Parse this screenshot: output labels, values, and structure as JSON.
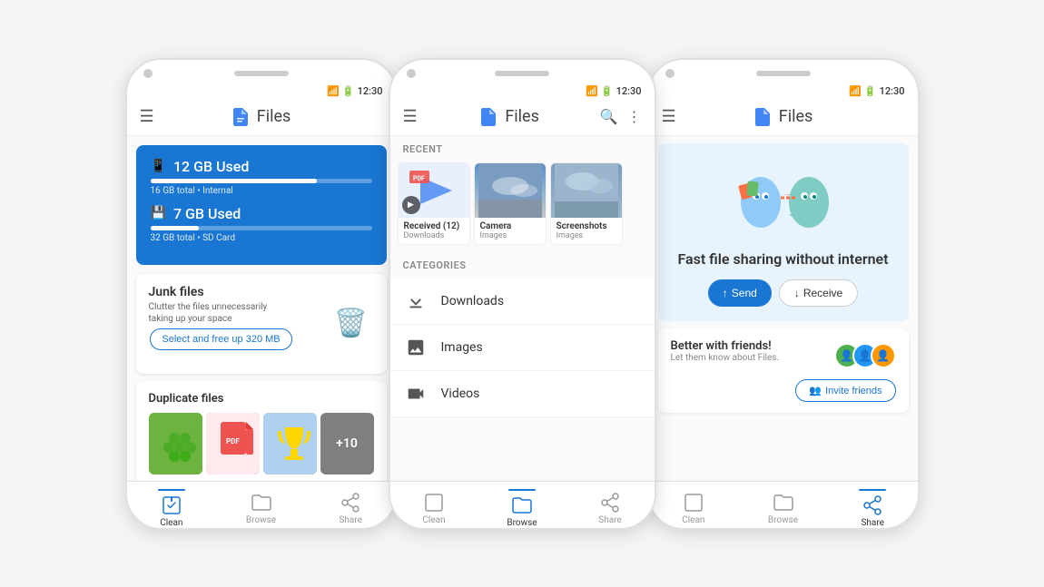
{
  "phone1": {
    "time": "12:30",
    "app_title": "Files",
    "storage1": {
      "label": "12 GB Used",
      "sub": "16 GB total • Internal",
      "progress": 75
    },
    "storage2": {
      "label": "7 GB Used",
      "sub": "32 GB total • SD Card",
      "progress": 22
    },
    "junk": {
      "title": "Junk files",
      "desc": "Clutter the files unnecessarily taking up your space",
      "btn": "Select and free up 320 MB"
    },
    "duplicates": {
      "title": "Duplicate files",
      "more": "+10"
    },
    "nav": {
      "clean": "Clean",
      "browse": "Browse",
      "share": "Share"
    }
  },
  "phone2": {
    "time": "12:30",
    "app_title": "Files",
    "recent_label": "RECENT",
    "recent": [
      {
        "name": "Received (12)",
        "sub": "Downloads",
        "type": "video"
      },
      {
        "name": "Camera",
        "sub": "Images",
        "type": "photo"
      },
      {
        "name": "Screenshots",
        "sub": "Images",
        "type": "photo"
      }
    ],
    "categories_label": "CATEGORIES",
    "categories": [
      {
        "name": "Downloads",
        "icon": "⬇"
      },
      {
        "name": "Images",
        "icon": "🖼"
      },
      {
        "name": "Videos",
        "icon": "📅"
      }
    ],
    "nav": {
      "clean": "Clean",
      "browse": "Browse",
      "share": "Share"
    }
  },
  "phone3": {
    "time": "12:30",
    "app_title": "Files",
    "sharing_title": "Fast file sharing without internet",
    "send_btn": "Send",
    "receive_btn": "Receive",
    "friends_title": "Better with friends!",
    "friends_desc": "Let them know about Files.",
    "invite_btn": "Invite friends",
    "nav": {
      "clean": "Clean",
      "browse": "Browse",
      "share": "Share"
    }
  }
}
